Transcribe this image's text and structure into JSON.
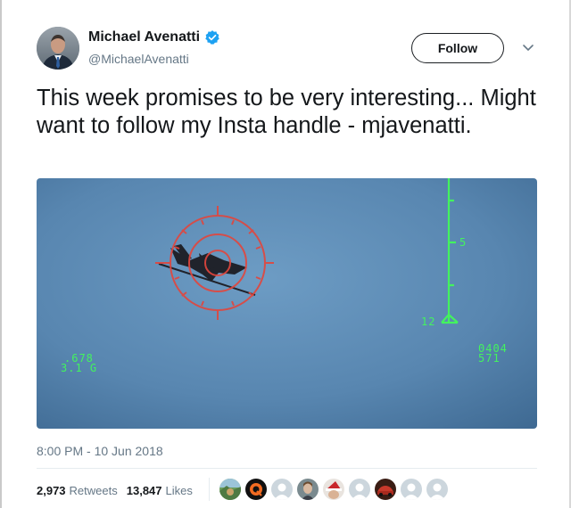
{
  "tweet": {
    "author": {
      "name": "Michael Avenatti",
      "handle": "@MichaelAvenatti",
      "verified": true
    },
    "follow_label": "Follow",
    "text": "This week promises to be very interesting... Might want to follow my Insta handle - mjavenatti.",
    "timestamp": "8:00 PM - 10 Jun 2018",
    "retweets": "2,973",
    "retweets_label": "Retweets",
    "likes": "13,847",
    "likes_label": "Likes"
  },
  "media": {
    "hud_left_1": ".678",
    "hud_left_2": "3.1 G",
    "hud_right_1": "0404",
    "hud_right_2": "571",
    "hud_scale_mark": "5",
    "hud_scale_bottom": "12"
  },
  "colors": {
    "hud_green": "#43f35e",
    "reticle_red": "#e2463d",
    "sky": "#5f8fb8",
    "verified_blue": "#1da1f2"
  },
  "likers": [
    {
      "icon": "avatar-landscape"
    },
    {
      "icon": "avatar-q-logo"
    },
    {
      "icon": "avatar-default"
    },
    {
      "icon": "avatar-portrait"
    },
    {
      "icon": "avatar-christmas"
    },
    {
      "icon": "avatar-default"
    },
    {
      "icon": "avatar-red-car"
    },
    {
      "icon": "avatar-default"
    },
    {
      "icon": "avatar-default"
    }
  ]
}
